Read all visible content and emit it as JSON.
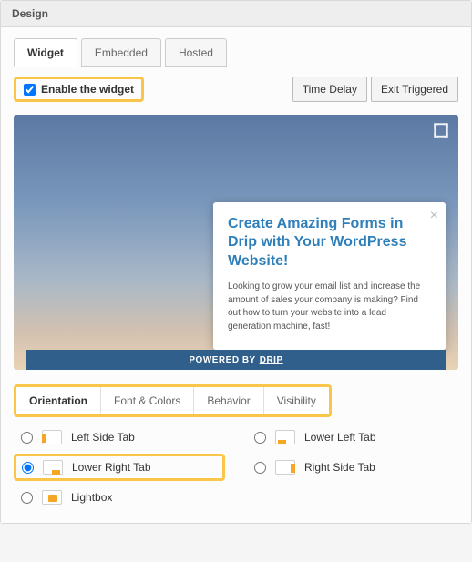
{
  "header": {
    "title": "Design"
  },
  "topTabs": [
    {
      "label": "Widget",
      "active": true
    },
    {
      "label": "Embedded",
      "active": false
    },
    {
      "label": "Hosted",
      "active": false
    }
  ],
  "enable": {
    "label": "Enable the widget",
    "checked": true
  },
  "buttons": {
    "timeDelay": "Time Delay",
    "exitTriggered": "Exit Triggered"
  },
  "preview": {
    "formTitle": "Create Amazing Forms in Drip with Your WordPress Website!",
    "formDesc": "Looking to grow your email list and increase the amount of sales your company is making? Find out how to turn your website into a lead generation machine, fast!",
    "poweredByPrefix": "POWERED BY",
    "poweredByBrand": "DRIP"
  },
  "subTabs": [
    {
      "label": "Orientation",
      "active": true
    },
    {
      "label": "Font & Colors",
      "active": false
    },
    {
      "label": "Behavior",
      "active": false
    },
    {
      "label": "Visibility",
      "active": false
    }
  ],
  "orientationOptions": {
    "leftSide": "Left Side Tab",
    "lowerLeft": "Lower Left Tab",
    "lowerRight": "Lower Right Tab",
    "rightSide": "Right Side Tab",
    "lightbox": "Lightbox"
  },
  "selectedOrientation": "lowerRight"
}
